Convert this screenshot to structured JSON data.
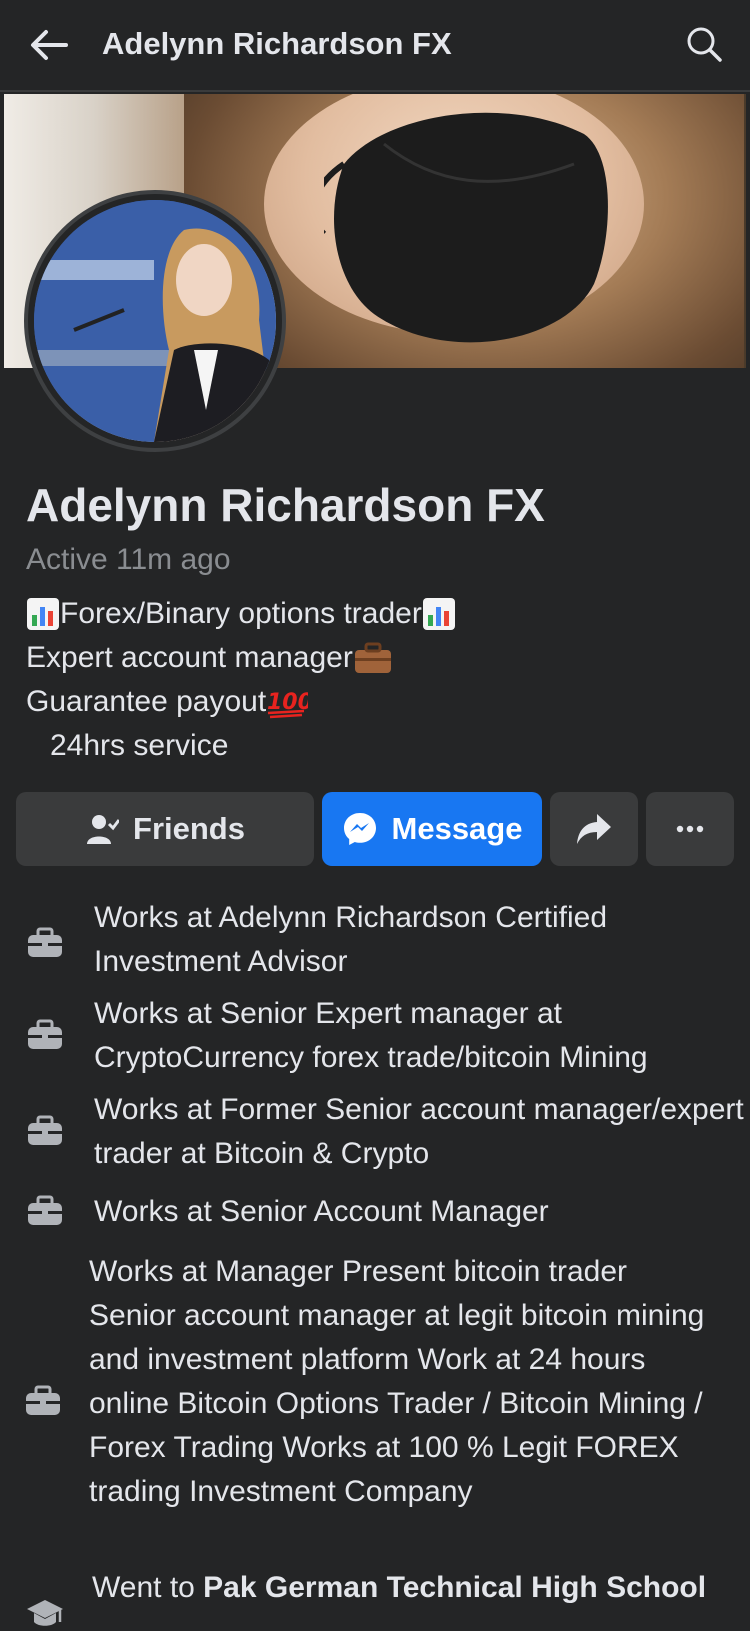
{
  "header": {
    "title": "Adelynn Richardson FX",
    "back_icon": "arrow-left-icon",
    "search_icon": "search-icon"
  },
  "profile": {
    "name": "Adelynn Richardson FX",
    "active_status": "Active 11m ago",
    "bio": {
      "line1": "Forex/Binary options trader",
      "line2": "Expert account manager",
      "line3": "Guarantee payout",
      "line4": "24hrs service"
    }
  },
  "actions": {
    "friends_label": "Friends",
    "message_label": "Message",
    "share_icon": "share-arrow-icon",
    "more_icon": "more-dots-icon"
  },
  "intro": {
    "work": [
      "Works at Adelynn Richardson Certified Investment Advisor",
      "Works at Senior Expert manager at CryptoCurrency forex trade/bitcoin Mining",
      "Works at Former Senior account manager/expert trader at Bitcoin & Crypto",
      "Works at Senior Account Manager",
      "Works at Manager  Present bitcoin trader Senior account manager at legit bitcoin mining and investment platform Work at 24 hours online Bitcoin Options Trader / Bitcoin Mining / Forex Trading Works at 100 % Legit FOREX trading Investment Company"
    ],
    "education_prefix": "Went to ",
    "education_school": "Pak German Technical High School"
  },
  "colors": {
    "background": "#242526",
    "button_secondary": "#3a3b3c",
    "button_primary": "#1877f2",
    "text_primary": "#e4e6eb",
    "text_secondary": "#8a8d91"
  }
}
